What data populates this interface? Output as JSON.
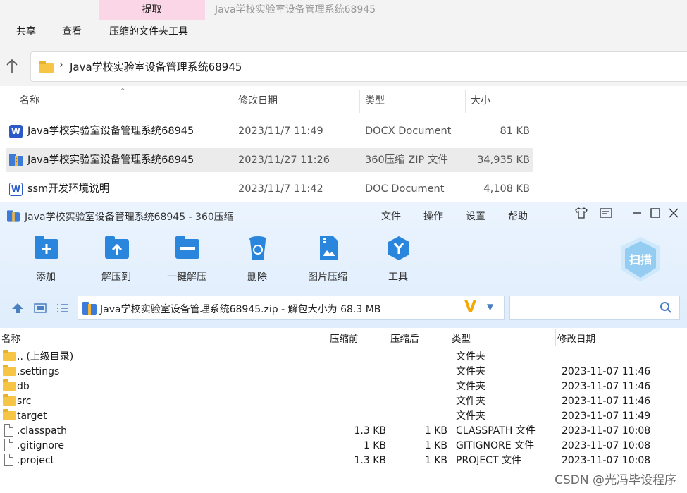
{
  "explorer": {
    "context_tab": "提取",
    "title": "Java学校实验室设备管理系统68945",
    "ribbon_tabs": [
      "共享",
      "查看",
      "压缩的文件夹工具"
    ],
    "address": "Java学校实验室设备管理系统68945",
    "columns": [
      "名称",
      "修改日期",
      "类型",
      "大小"
    ],
    "files": [
      {
        "name": "Java学校实验室设备管理系统68945",
        "date": "2023/11/7 11:49",
        "type": "DOCX Document",
        "size": "81 KB",
        "icon": "word-icon"
      },
      {
        "name": "Java学校实验室设备管理系统68945",
        "date": "2023/11/27 11:26",
        "type": "360压缩 ZIP 文件",
        "size": "34,935 KB",
        "icon": "zip-icon"
      },
      {
        "name": "ssm开发环境说明",
        "date": "2023/11/7 11:42",
        "type": "DOC Document",
        "size": "4,108 KB",
        "icon": "word-outline-icon"
      }
    ]
  },
  "zip": {
    "title": "Java学校实验室设备管理系统68945 - 360压缩",
    "menu": [
      "文件",
      "操作",
      "设置",
      "帮助"
    ],
    "toolbar": [
      {
        "label": "添加",
        "icon": "add-icon"
      },
      {
        "label": "解压到",
        "icon": "extract-to-icon"
      },
      {
        "label": "一键解压",
        "icon": "one-click-extract-icon"
      },
      {
        "label": "删除",
        "icon": "delete-icon"
      },
      {
        "label": "图片压缩",
        "icon": "image-compress-icon"
      },
      {
        "label": "工具",
        "icon": "tools-icon"
      }
    ],
    "scan_label": "扫描",
    "address": "Java学校实验室设备管理系统68945.zip - 解包大小为 68.3 MB",
    "search_placeholder": "",
    "columns": [
      "名称",
      "压缩前",
      "压缩后",
      "类型",
      "修改日期"
    ],
    "rows": [
      {
        "name": ".. (上级目录)",
        "before": "",
        "after": "",
        "type": "文件夹",
        "modified": "",
        "kind": "folder"
      },
      {
        "name": ".settings",
        "before": "",
        "after": "",
        "type": "文件夹",
        "modified": "2023-11-07 11:46",
        "kind": "folder"
      },
      {
        "name": "db",
        "before": "",
        "after": "",
        "type": "文件夹",
        "modified": "2023-11-07 11:46",
        "kind": "folder"
      },
      {
        "name": "src",
        "before": "",
        "after": "",
        "type": "文件夹",
        "modified": "2023-11-07 11:46",
        "kind": "folder"
      },
      {
        "name": "target",
        "before": "",
        "after": "",
        "type": "文件夹",
        "modified": "2023-11-07 11:49",
        "kind": "folder"
      },
      {
        "name": ".classpath",
        "before": "1.3 KB",
        "after": "1 KB",
        "type": "CLASSPATH 文件",
        "modified": "2023-11-07 10:08",
        "kind": "file"
      },
      {
        "name": ".gitignore",
        "before": "1 KB",
        "after": "1 KB",
        "type": "GITIGNORE 文件",
        "modified": "2023-11-07 10:08",
        "kind": "file"
      },
      {
        "name": ".project",
        "before": "1.3 KB",
        "after": "1 KB",
        "type": "PROJECT 文件",
        "modified": "2023-11-07 10:08",
        "kind": "file"
      }
    ]
  },
  "watermark": "CSDN @光冯毕设程序",
  "colors": {
    "accent": "#2a86dc",
    "context_tab": "#fbd6e6",
    "zip_header": "#e4f0fd",
    "folder": "#f6c545"
  }
}
